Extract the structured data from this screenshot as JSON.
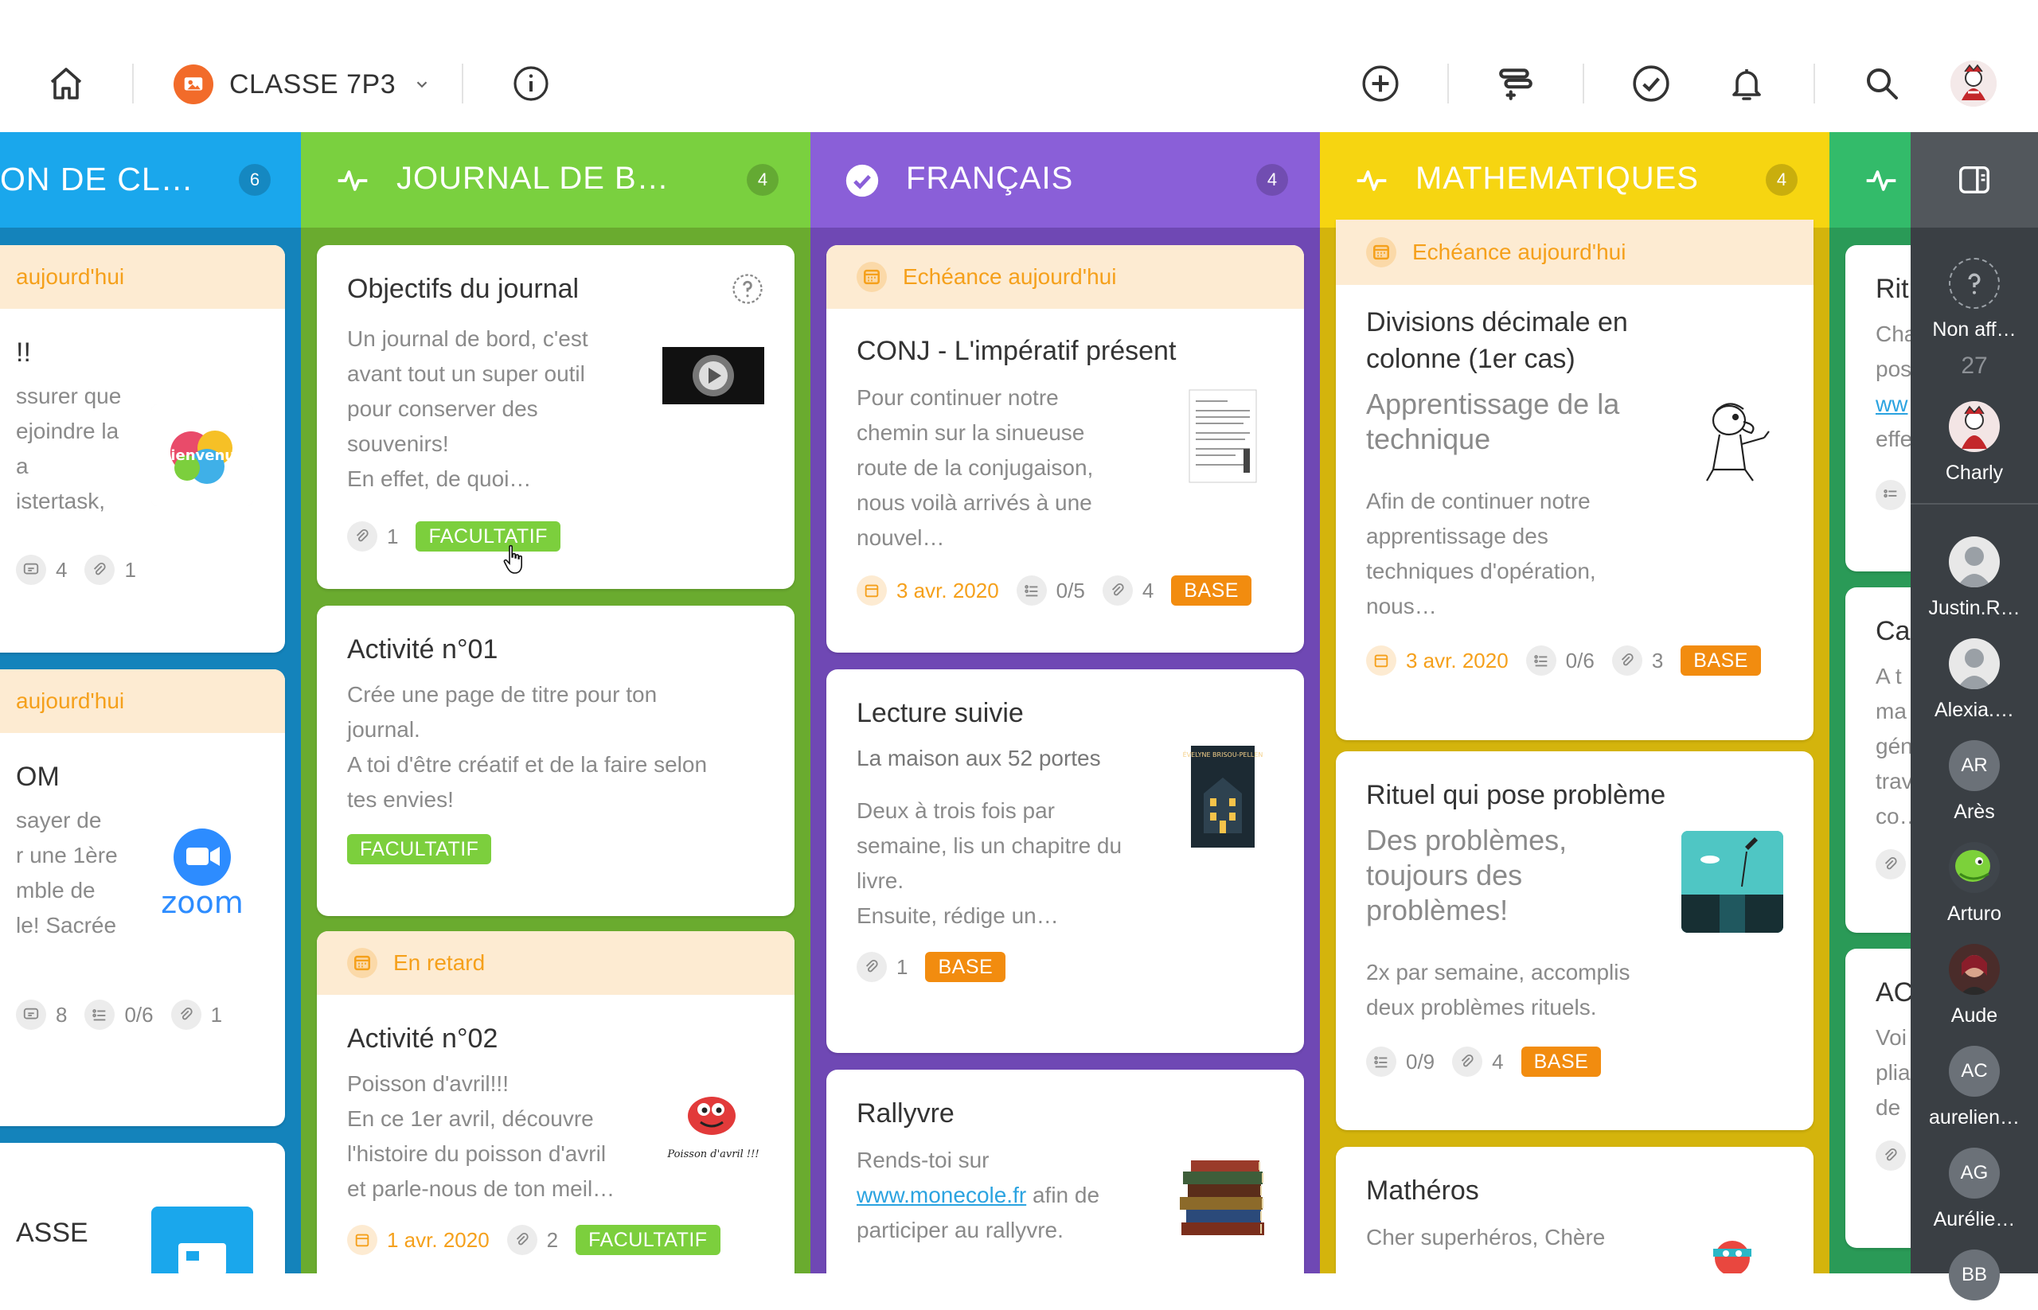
{
  "topbar": {
    "class_name": "CLASSE 7P3",
    "icons": [
      "home-icon",
      "info-icon",
      "add-icon",
      "sort-icon",
      "check-icon",
      "bell-icon",
      "search-icon"
    ]
  },
  "colors": {
    "col1": "#1aa7ec",
    "col2": "#7ad03f",
    "col3": "#8a5fd8",
    "col4": "#f6d511",
    "col5": "#33bb6a",
    "due_bg": "#fdebd2",
    "due_text": "#f5a01b",
    "tag_base": "#f28c0f",
    "tag_facultatif": "#7ccf3d",
    "sidebar": "#3a3f44"
  },
  "columns": [
    {
      "title": "ON DE CL…",
      "count": "6",
      "cards": [
        {
          "due": "aujourd'hui",
          "title": "!!",
          "text": "ssurer que\nejoindre la\na\nistertask,",
          "thumb_label": "Bienvenue",
          "m_comments": "4",
          "m_attach": "1"
        },
        {
          "due": "aujourd'hui",
          "title": "OM",
          "text": "sayer de\nr une 1ère\nmble de\nle! Sacrée",
          "thumb_label": "zoom",
          "m_comments": "8",
          "m_tasks": "0/6",
          "m_attach": "1"
        },
        {
          "title": "ASSE"
        }
      ]
    },
    {
      "title": "JOURNAL DE B…",
      "count": "4",
      "cards": [
        {
          "title": "Objectifs du journal",
          "text": "Un journal de bord, c'est\navant tout un super outil\npour conserver des\nsouvenirs!\nEn effet, de quoi…",
          "m_attach": "1",
          "tag": "FACULTATIF"
        },
        {
          "title": "Activité n°01",
          "text": "Crée une page de titre pour ton\njournal.\nA toi d'être créatif et de la faire selon\ntes envies!",
          "tag": "FACULTATIF"
        },
        {
          "due": "En retard",
          "title": "Activité n°02",
          "text": "Poisson d'avril!!!\nEn ce 1er avril, découvre\nl'histoire du poisson d'avril\net parle-nous de ton meil…",
          "thumb_label": "Poisson d'avril !!!",
          "date": "1 avr. 2020",
          "m_attach": "2",
          "tag": "FACULTATIF"
        }
      ]
    },
    {
      "title": "FRANÇAIS",
      "count": "4",
      "cards": [
        {
          "due": "Echéance aujourd'hui",
          "title": "CONJ - L'impératif présent",
          "text": "Pour continuer notre\nchemin sur la sinueuse\nroute de la conjugaison,\nnous voilà arrivés à une\nnouvel…",
          "date": "3 avr. 2020",
          "m_tasks": "0/5",
          "m_attach": "4",
          "tag": "BASE"
        },
        {
          "title": "Lecture suivie",
          "subtitle": "La maison aux 52 portes",
          "text": "Deux à trois fois par\nsemaine, lis un chapitre du\nlivre.\nEnsuite, rédige un…",
          "thumb_label": "ÉVELYNE BRISOU-PELLEN",
          "m_attach": "1",
          "tag": "BASE"
        },
        {
          "title": "Rallyvre",
          "text_before": "Rends-toi sur",
          "link": "www.monecole.fr",
          "text_after": " afin de\nparticiper au rallyvre."
        }
      ]
    },
    {
      "title": "MATHEMATIQUES",
      "count": "4",
      "cards": [
        {
          "due": "Echéance aujourd'hui",
          "title": "Divisions décimale en colonne (1er cas)",
          "subtitle": "Apprentissage de la technique",
          "text": "Afin de continuer notre\napprentissage des\ntechniques d'opération,\nnous…",
          "date": "3 avr. 2020",
          "m_tasks": "0/6",
          "m_attach": "3",
          "tag": "BASE"
        },
        {
          "title": "Rituel qui pose problème",
          "subtitle": "Des problèmes, toujours des problèmes!",
          "text": "2x par semaine, accomplis\ndeux problèmes rituels.",
          "m_tasks": "0/9",
          "m_attach": "4",
          "tag": "BASE"
        },
        {
          "title": "Mathéros",
          "text": "Cher superhéros, Chère"
        }
      ]
    },
    {
      "title": "",
      "cards": [
        {
          "title": "Rit",
          "text": "Cha\npos",
          "link": "ww",
          "text_after": "effe"
        },
        {
          "title": "Ca",
          "text": "A t\nma\ngén\ntrav\nco…"
        },
        {
          "title": "AC",
          "text": "Voi\nplia\nde"
        }
      ]
    }
  ],
  "sidebar": {
    "unassigned_label": "Non aff…",
    "unassigned_count": "27",
    "members": [
      {
        "name": "Charly"
      },
      {
        "name": "Justin.R…"
      },
      {
        "name": "Alexia.…"
      },
      {
        "name": "Arès",
        "initials": "AR"
      },
      {
        "name": "Arturo"
      },
      {
        "name": "Aude"
      },
      {
        "name": "aurelien…",
        "initials": "AC"
      },
      {
        "name": "Aurélie…",
        "initials": "AG"
      },
      {
        "initials": "BB"
      }
    ]
  }
}
